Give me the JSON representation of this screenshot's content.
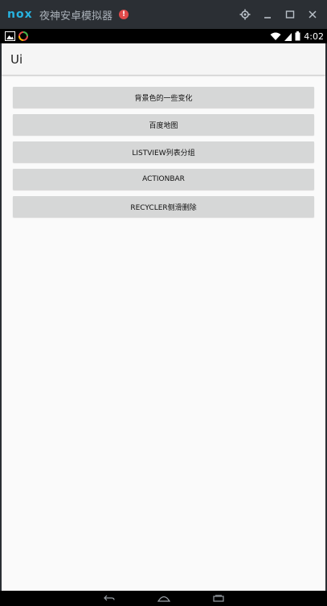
{
  "emulator": {
    "logo_text": "nox",
    "title": "夜神安卓模拟器",
    "alert_glyph": "!",
    "accent_color": "#27b3e0"
  },
  "status_bar": {
    "time": "4:02"
  },
  "app": {
    "title": "Ui",
    "buttons": [
      {
        "label": "背景色的一些变化"
      },
      {
        "label": "百度地图"
      },
      {
        "label": "LISTVIEW列表分组"
      },
      {
        "label": "ACTIONBAR"
      },
      {
        "label": "RECYCLER侧滑删除"
      }
    ]
  }
}
